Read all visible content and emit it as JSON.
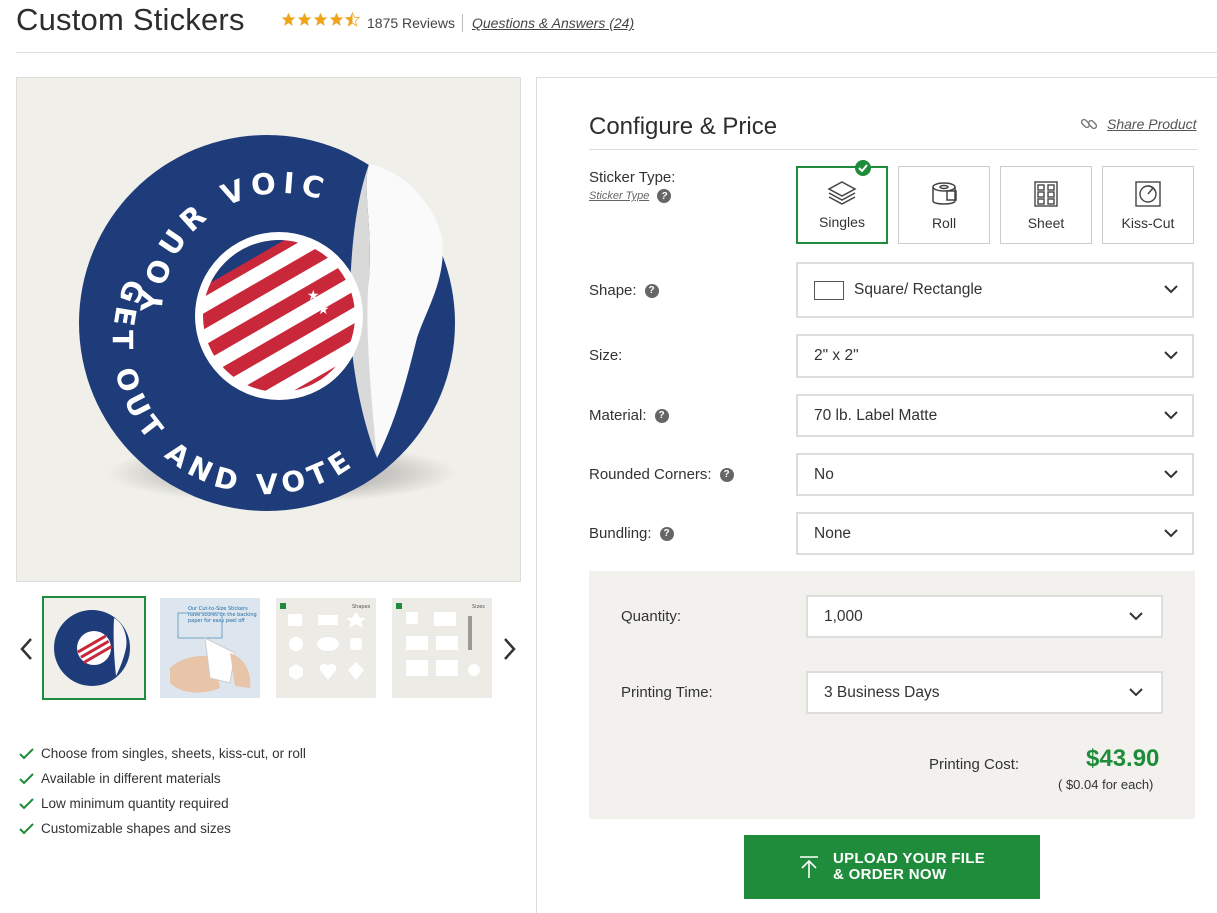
{
  "header": {
    "title": "Custom Stickers",
    "rating": 4.5,
    "reviews": "1875 Reviews",
    "qa_link": "Questions & Answers (24)"
  },
  "gallery": {
    "main_image": "get-out-and-vote-round-sticker",
    "sticker_text_top": "YOUR VOIC",
    "sticker_text_bottom": "GET OUT AND VOTE",
    "thumbnails": [
      {
        "name": "get-out-and-vote-sticker",
        "selected": true
      },
      {
        "name": "cut-to-size-stickers-peel",
        "caption": "Our Cut-to-Size Stickers have scores on the backing paper for easy peel off",
        "selected": false
      },
      {
        "name": "shapes-chart",
        "heading": "Shapes",
        "selected": false
      },
      {
        "name": "sizes-chart",
        "heading": "Sizes",
        "selected": false
      }
    ]
  },
  "features": [
    "Choose from singles, sheets, kiss-cut, or roll",
    "Available in different materials",
    "Low minimum quantity required",
    "Customizable shapes and sizes"
  ],
  "configure": {
    "title": "Configure & Price",
    "share": "Share Product",
    "sticker_type_label": "Sticker Type:",
    "sticker_type_link": "Sticker Type",
    "sticker_types": [
      {
        "label": "Singles",
        "icon": "layers-icon",
        "selected": true
      },
      {
        "label": "Roll",
        "icon": "roll-icon",
        "selected": false
      },
      {
        "label": "Sheet",
        "icon": "sheet-icon",
        "selected": false
      },
      {
        "label": "Kiss-Cut",
        "icon": "kiss-cut-icon",
        "selected": false
      }
    ],
    "shape": {
      "label": "Shape:",
      "value": "Square/ Rectangle"
    },
    "size": {
      "label": "Size:",
      "value": "2\" x 2\""
    },
    "material": {
      "label": "Material:",
      "value": "70 lb. Label Matte"
    },
    "rounded_corners": {
      "label": "Rounded Corners:",
      "value": "No"
    },
    "bundling": {
      "label": "Bundling:",
      "value": "None"
    }
  },
  "pricing": {
    "quantity_label": "Quantity:",
    "quantity": "1,000",
    "printing_time_label": "Printing Time:",
    "printing_time": "3 Business Days",
    "cost_label": "Printing Cost:",
    "price": "$43.90",
    "each": "( $0.04 for each)"
  },
  "cta": {
    "line1": "UPLOAD YOUR FILE",
    "line2": "& ORDER NOW"
  },
  "colors": {
    "brand_green": "#1e8c3a",
    "star_gold": "#f0a41c",
    "sticker_navy": "#1e3a78",
    "flag_red": "#c8283a"
  }
}
